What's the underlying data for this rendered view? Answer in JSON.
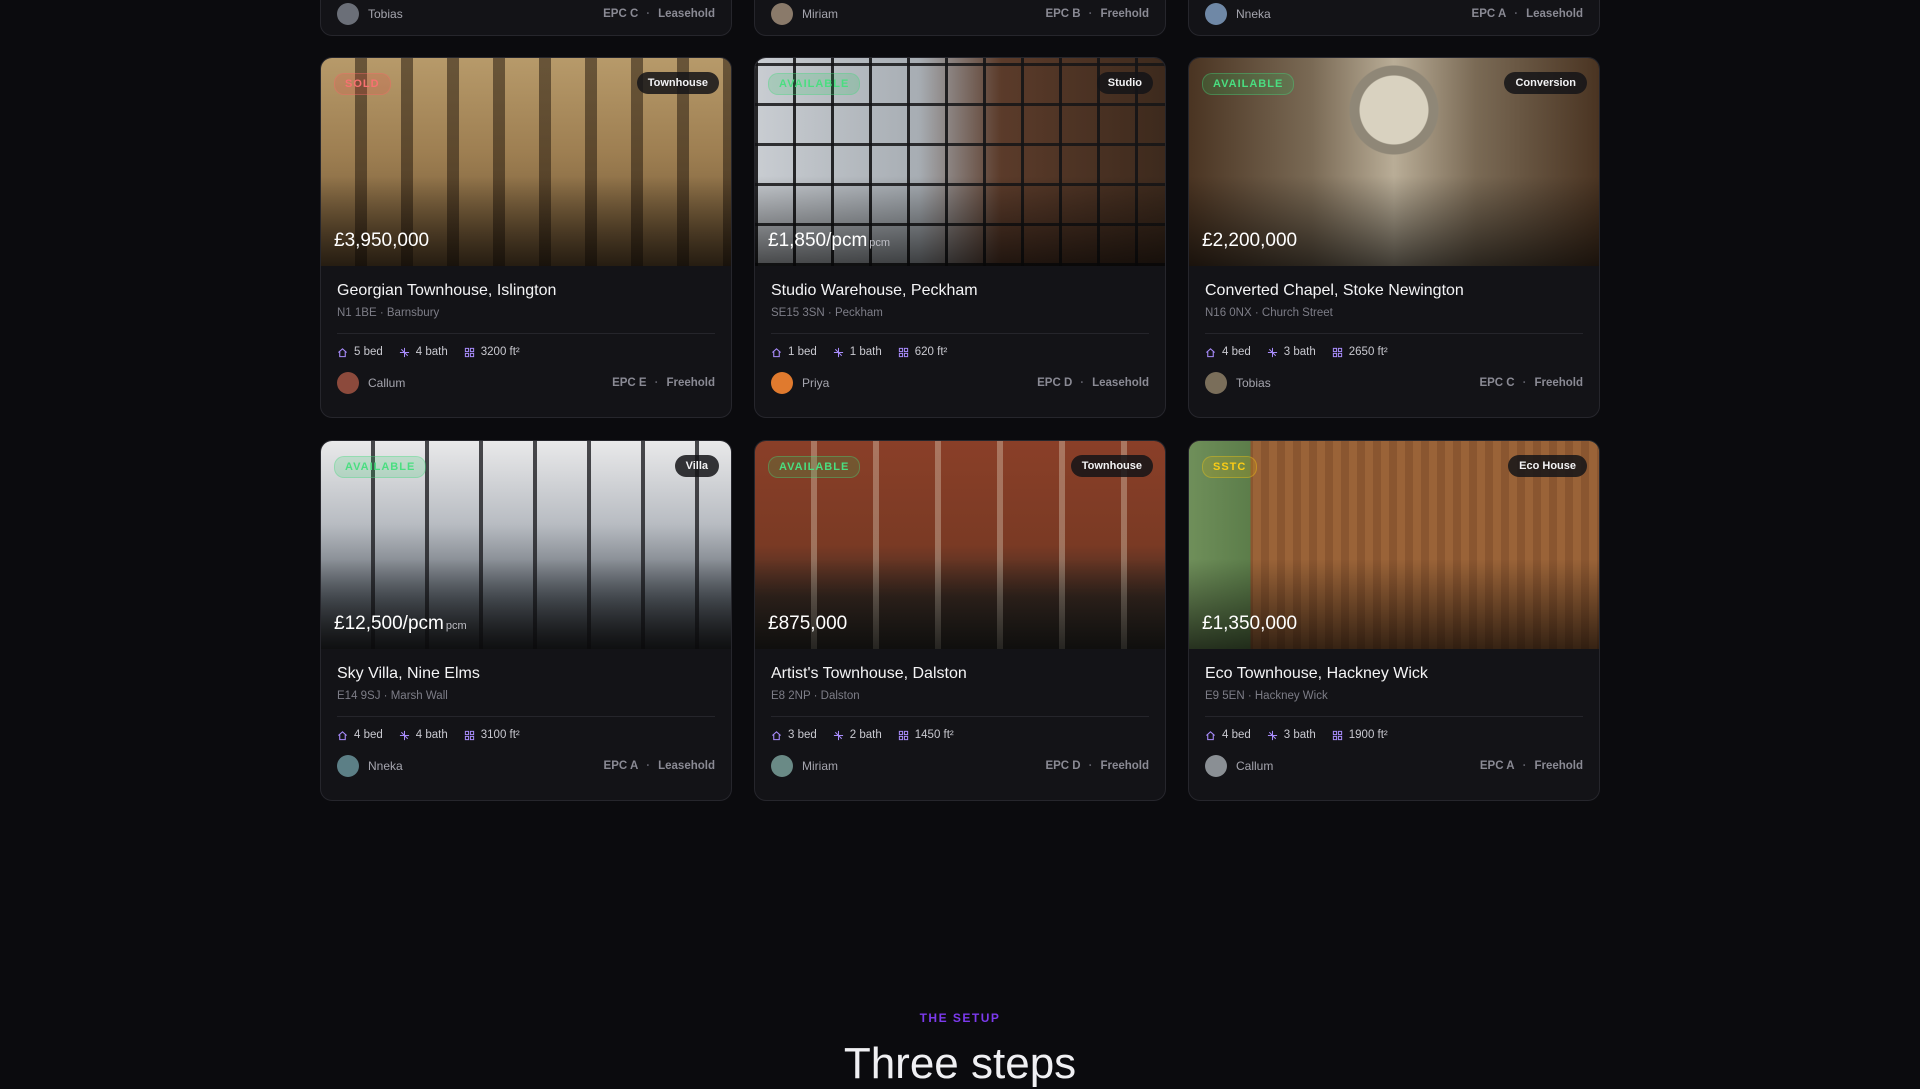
{
  "top_row": [
    {
      "agent": "Tobias",
      "epc": "EPC C",
      "tenure": "Leasehold",
      "avatar_color": "#6b6f78"
    },
    {
      "agent": "Miriam",
      "epc": "EPC B",
      "tenure": "Freehold",
      "avatar_color": "#8a7a6a"
    },
    {
      "agent": "Nneka",
      "epc": "EPC A",
      "tenure": "Leasehold",
      "avatar_color": "#6f88a6"
    }
  ],
  "listings": [
    {
      "status": "SOLD",
      "status_kind": "sold",
      "type": "Townhouse",
      "price": "£3,950,000",
      "price_unit": "",
      "title": "Georgian Townhouse, Islington",
      "postcode": "N1 1BE",
      "area": "Barnsbury",
      "beds": "5 bed",
      "baths": "4 bath",
      "size": "3200 ft²",
      "agent": "Callum",
      "epc": "EPC E",
      "tenure": "Freehold",
      "avatar_color": "#8c4a3c",
      "photo": "georgian"
    },
    {
      "status": "AVAILABLE",
      "status_kind": "available",
      "type": "Studio",
      "price": "£1,850/pcm",
      "price_unit": "pcm",
      "title": "Studio Warehouse, Peckham",
      "postcode": "SE15 3SN",
      "area": "Peckham",
      "beds": "1 bed",
      "baths": "1 bath",
      "size": "620 ft²",
      "agent": "Priya",
      "epc": "EPC D",
      "tenure": "Leasehold",
      "avatar_color": "#e07a2e",
      "photo": "studio"
    },
    {
      "status": "AVAILABLE",
      "status_kind": "available",
      "type": "Conversion",
      "price": "£2,200,000",
      "price_unit": "",
      "title": "Converted Chapel, Stoke Newington",
      "postcode": "N16 0NX",
      "area": "Church Street",
      "beds": "4 bed",
      "baths": "3 bath",
      "size": "2650 ft²",
      "agent": "Tobias",
      "epc": "EPC C",
      "tenure": "Freehold",
      "avatar_color": "#7a6e5a",
      "photo": "chapel"
    },
    {
      "status": "AVAILABLE",
      "status_kind": "available",
      "type": "Villa",
      "price": "£12,500/pcm",
      "price_unit": "pcm",
      "title": "Sky Villa, Nine Elms",
      "postcode": "E14 9SJ",
      "area": "Marsh Wall",
      "beds": "4 bed",
      "baths": "4 bath",
      "size": "3100 ft²",
      "agent": "Nneka",
      "epc": "EPC A",
      "tenure": "Leasehold",
      "avatar_color": "#5c7f86",
      "photo": "sky"
    },
    {
      "status": "AVAILABLE",
      "status_kind": "available",
      "type": "Townhouse",
      "price": "£875,000",
      "price_unit": "",
      "title": "Artist's Townhouse, Dalston",
      "postcode": "E8 2NP",
      "area": "Dalston",
      "beds": "3 bed",
      "baths": "2 bath",
      "size": "1450 ft²",
      "agent": "Miriam",
      "epc": "EPC D",
      "tenure": "Freehold",
      "avatar_color": "#6a8a86",
      "photo": "artist"
    },
    {
      "status": "SSTC",
      "status_kind": "sstc",
      "type": "Eco House",
      "price": "£1,350,000",
      "price_unit": "",
      "title": "Eco Townhouse, Hackney Wick",
      "postcode": "E9 5EN",
      "area": "Hackney Wick",
      "beds": "4 bed",
      "baths": "3 bath",
      "size": "1900 ft²",
      "agent": "Callum",
      "epc": "EPC A",
      "tenure": "Freehold",
      "avatar_color": "#8a8f94",
      "photo": "eco"
    }
  ],
  "setup": {
    "label": "THE SETUP",
    "title": "Three steps"
  },
  "icons": {
    "bed": "home-icon",
    "bath": "sparkle-icon",
    "size": "grid-icon"
  },
  "colors": {
    "accent": "#7c3aed",
    "available": "#4ade80",
    "sold": "#f87171",
    "sstc": "#facc15"
  }
}
